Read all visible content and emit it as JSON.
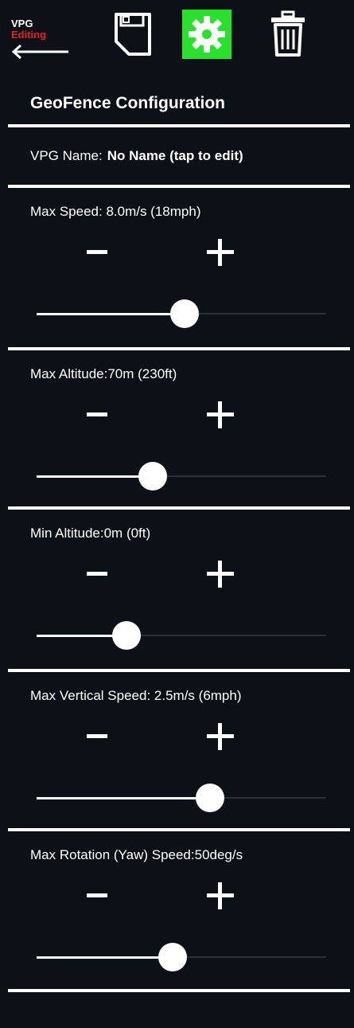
{
  "header": {
    "back_line1": "VPG",
    "back_line2": "Editing",
    "back_line2_color": "#e8211f",
    "settings_active_color": "#27e22a",
    "icons": [
      "back-arrow-icon",
      "save-icon",
      "gear-icon",
      "trash-icon"
    ]
  },
  "title": "GeoFence Configuration",
  "vpg_name": {
    "label": "VPG Name:",
    "value": "No Name (tap to edit)"
  },
  "settings": [
    {
      "label": "Max Speed: 8.0m/s (18mph)",
      "minus": "-",
      "plus": "+",
      "slider_fraction": 0.51
    },
    {
      "label": "Max Altitude:70m (230ft)",
      "minus": "-",
      "plus": "+",
      "slider_fraction": 0.4
    },
    {
      "label": "Min Altitude:0m (0ft)",
      "minus": "-",
      "plus": "+",
      "slider_fraction": 0.31
    },
    {
      "label": "Max Vertical Speed: 2.5m/s (6mph)",
      "minus": "-",
      "plus": "+",
      "slider_fraction": 0.6
    },
    {
      "label": "Max Rotation (Yaw) Speed:50deg/s",
      "minus": "-",
      "plus": "+",
      "slider_fraction": 0.47
    }
  ]
}
